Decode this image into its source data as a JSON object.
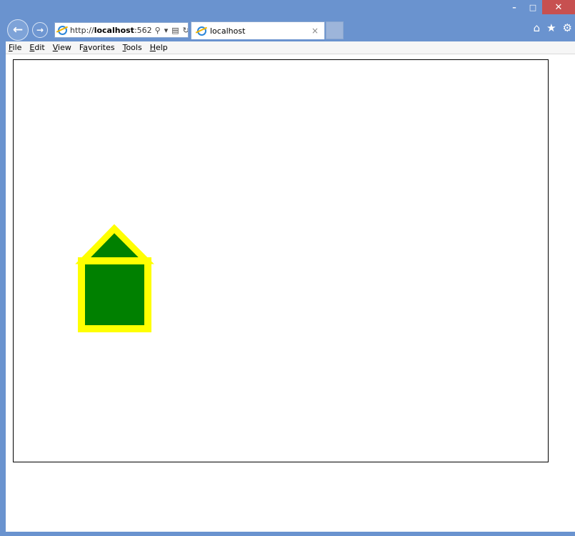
{
  "browser": {
    "address": {
      "url_prefix": "http://",
      "url_host": "localhost",
      "url_port": ":562"
    },
    "tab": {
      "title": "localhost",
      "close_glyph": "×"
    },
    "window_controls": {
      "minimize": "–",
      "maximize": "□",
      "close": "✕"
    },
    "toolbar_icons": [
      "home-icon",
      "favorites-star-icon",
      "settings-gear-icon"
    ]
  },
  "menu": {
    "items": [
      {
        "accel": "F",
        "rest": "ile"
      },
      {
        "accel": "E",
        "rest": "dit"
      },
      {
        "accel": "V",
        "rest": "iew"
      },
      {
        "accel": "a",
        "prefix": "F",
        "rest": "vorites"
      },
      {
        "accel": "T",
        "rest": "ools"
      },
      {
        "accel": "H",
        "rest": "elp"
      }
    ]
  },
  "drawing": {
    "fill_color": "#008000",
    "stroke_color": "#ffff00",
    "shapes": [
      "roof-triangle",
      "house-body-square"
    ]
  }
}
